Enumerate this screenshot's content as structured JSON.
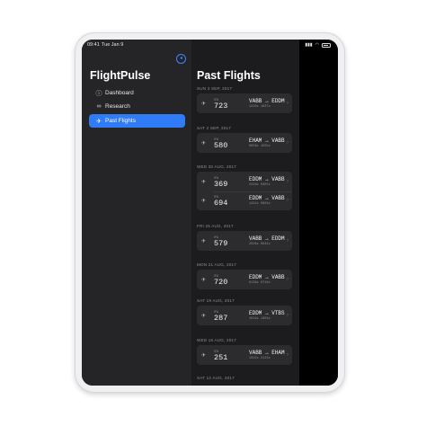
{
  "status_bar": {
    "time": "09:41",
    "date": "Tue Jan 9"
  },
  "sidebar": {
    "title": "FlightPulse",
    "items": [
      {
        "label": "Dashboard",
        "icon": "info-circle-icon",
        "active": false
      },
      {
        "label": "Research",
        "icon": "binoculars-icon",
        "active": false
      },
      {
        "label": "Past Flights",
        "icon": "airplane-icon",
        "active": true
      }
    ],
    "accent": "#2f7cf6"
  },
  "main": {
    "title": "Past Flights",
    "groups": [
      {
        "date": "SUN 3 SEP, 2017",
        "flights": [
          {
            "carrier": "IFA",
            "number": "723",
            "from": "VABB",
            "to": "EDDM",
            "times": "1220z   1837z"
          }
        ]
      },
      {
        "date": "SAT 2 SEP, 2017",
        "flights": [
          {
            "carrier": "IFA",
            "number": "580",
            "from": "EHAM",
            "to": "VABB",
            "times": "0656z   1555z"
          }
        ]
      },
      {
        "date": "WED 30 AUG, 2017",
        "flights": [
          {
            "carrier": "IFA",
            "number": "369",
            "from": "EDDM",
            "to": "VABB",
            "times": "2318z   0303z"
          },
          {
            "carrier": "IFA",
            "number": "694",
            "from": "EDDM",
            "to": "VABB",
            "times": "1432z   0803z"
          }
        ]
      },
      {
        "date": "FRI 25 AUG, 2017",
        "flights": [
          {
            "carrier": "IFA",
            "number": "579",
            "from": "VABB",
            "to": "EDDM",
            "times": "2026z   0044z"
          }
        ]
      },
      {
        "date": "MON 21 AUG, 2017",
        "flights": [
          {
            "carrier": "IFA",
            "number": "720",
            "from": "EDDM",
            "to": "VABB",
            "times": "0138z   0716z"
          }
        ]
      },
      {
        "date": "SAT 19 AUG, 2017",
        "flights": [
          {
            "carrier": "IFA",
            "number": "287",
            "from": "EDDM",
            "to": "VTBS",
            "times": "1619z   1303z"
          }
        ]
      },
      {
        "date": "WED 16 AUG, 2017",
        "flights": [
          {
            "carrier": "IFA",
            "number": "251",
            "from": "VABB",
            "to": "EHAM",
            "times": "1322z   2123z"
          }
        ]
      },
      {
        "date": "SAT 12 AUG, 2017",
        "flights": []
      }
    ]
  }
}
